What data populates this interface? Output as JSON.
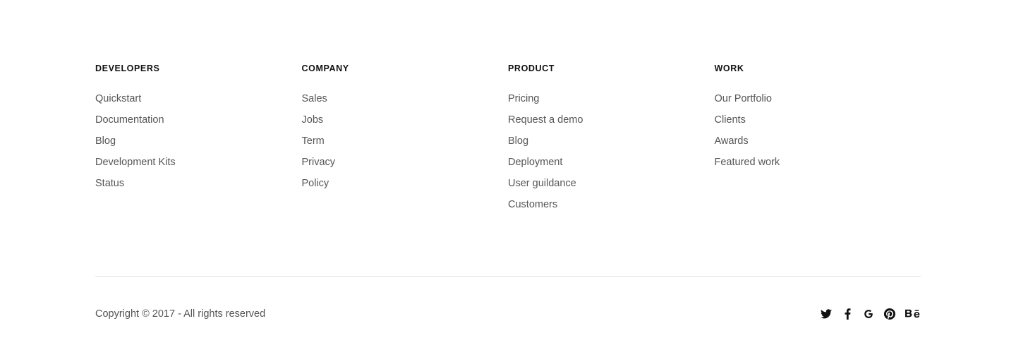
{
  "columns": [
    {
      "heading": "DEVELOPERS",
      "links": [
        "Quickstart",
        "Documentation",
        "Blog",
        "Development Kits",
        "Status"
      ]
    },
    {
      "heading": "COMPANY",
      "links": [
        "Sales",
        "Jobs",
        "Term",
        "Privacy",
        "Policy"
      ]
    },
    {
      "heading": "PRODUCT",
      "links": [
        "Pricing",
        "Request a demo",
        "Blog",
        "Deployment",
        "User guildance",
        "Customers"
      ]
    },
    {
      "heading": "WORK",
      "links": [
        "Our Portfolio",
        "Clients",
        "Awards",
        "Featured work"
      ]
    }
  ],
  "footer": {
    "copyright": "Copyright © 2017 - All rights reserved"
  },
  "social": [
    {
      "icon": "twitter-icon"
    },
    {
      "icon": "facebook-icon"
    },
    {
      "icon": "google-icon"
    },
    {
      "icon": "pinterest-icon"
    },
    {
      "icon": "behance-icon"
    }
  ],
  "colors": {
    "background": "#ffffff",
    "heading": "#111111",
    "text": "#555555",
    "divider": "#e3e3e3",
    "icon": "#111111"
  }
}
